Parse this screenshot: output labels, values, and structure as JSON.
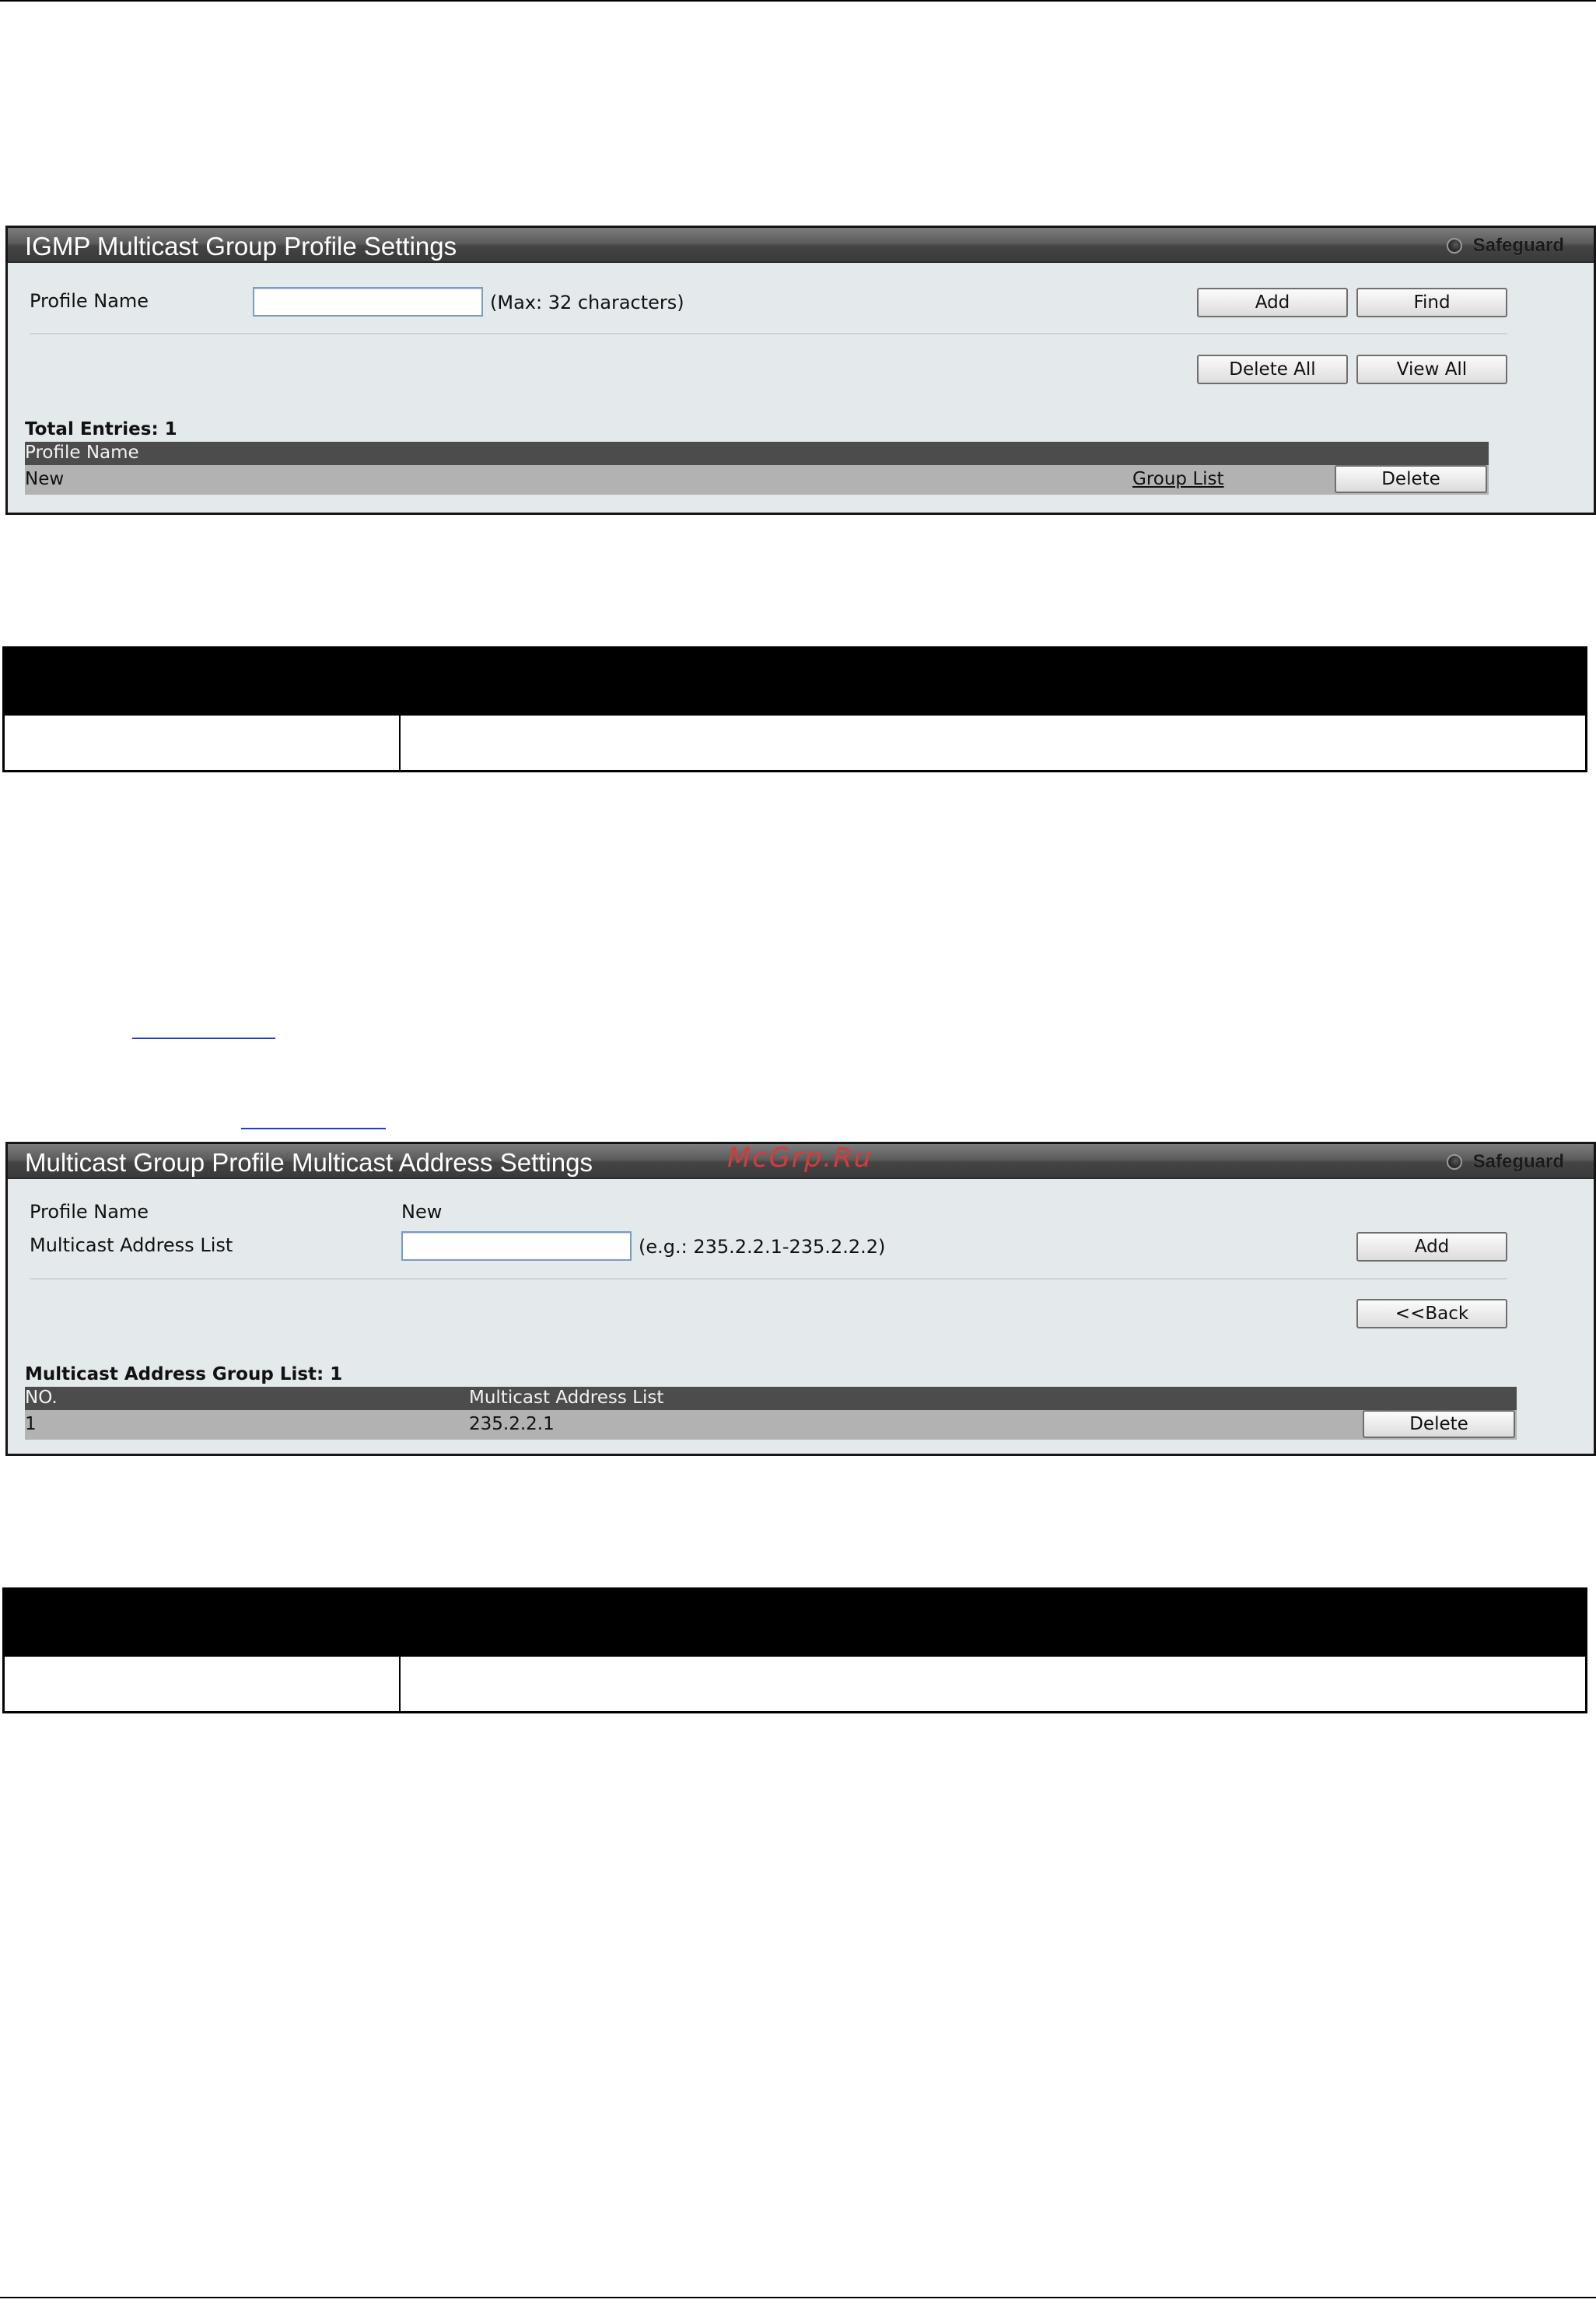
{
  "panel1": {
    "title": "IGMP Multicast Group Profile Settings",
    "safeguard": "Safeguard",
    "profile_name_label": "Profile Name",
    "profile_name_value": "",
    "max_hint": "(Max: 32 characters)",
    "add_label": "Add",
    "find_label": "Find",
    "delete_all_label": "Delete All",
    "view_all_label": "View All",
    "total_entries": "Total Entries: 1",
    "table_header": "Profile Name",
    "rows": [
      {
        "name": "New",
        "link": "Group List",
        "action": "Delete"
      }
    ]
  },
  "panel2": {
    "title": "Multicast Group Profile Multicast Address Settings",
    "safeguard": "Safeguard",
    "watermark": "McGrp.Ru",
    "profile_name_label": "Profile Name",
    "profile_name_value": "New",
    "address_list_label": "Multicast Address List",
    "address_list_value": "",
    "example_hint": "(e.g.: 235.2.2.1-235.2.2.2)",
    "add_label": "Add",
    "back_label": "<<Back",
    "group_list_count": "Multicast Address Group List: 1",
    "columns": [
      "NO.",
      "Multicast Address List"
    ],
    "rows": [
      {
        "no": "1",
        "address": "235.2.2.1",
        "action": "Delete"
      }
    ]
  }
}
